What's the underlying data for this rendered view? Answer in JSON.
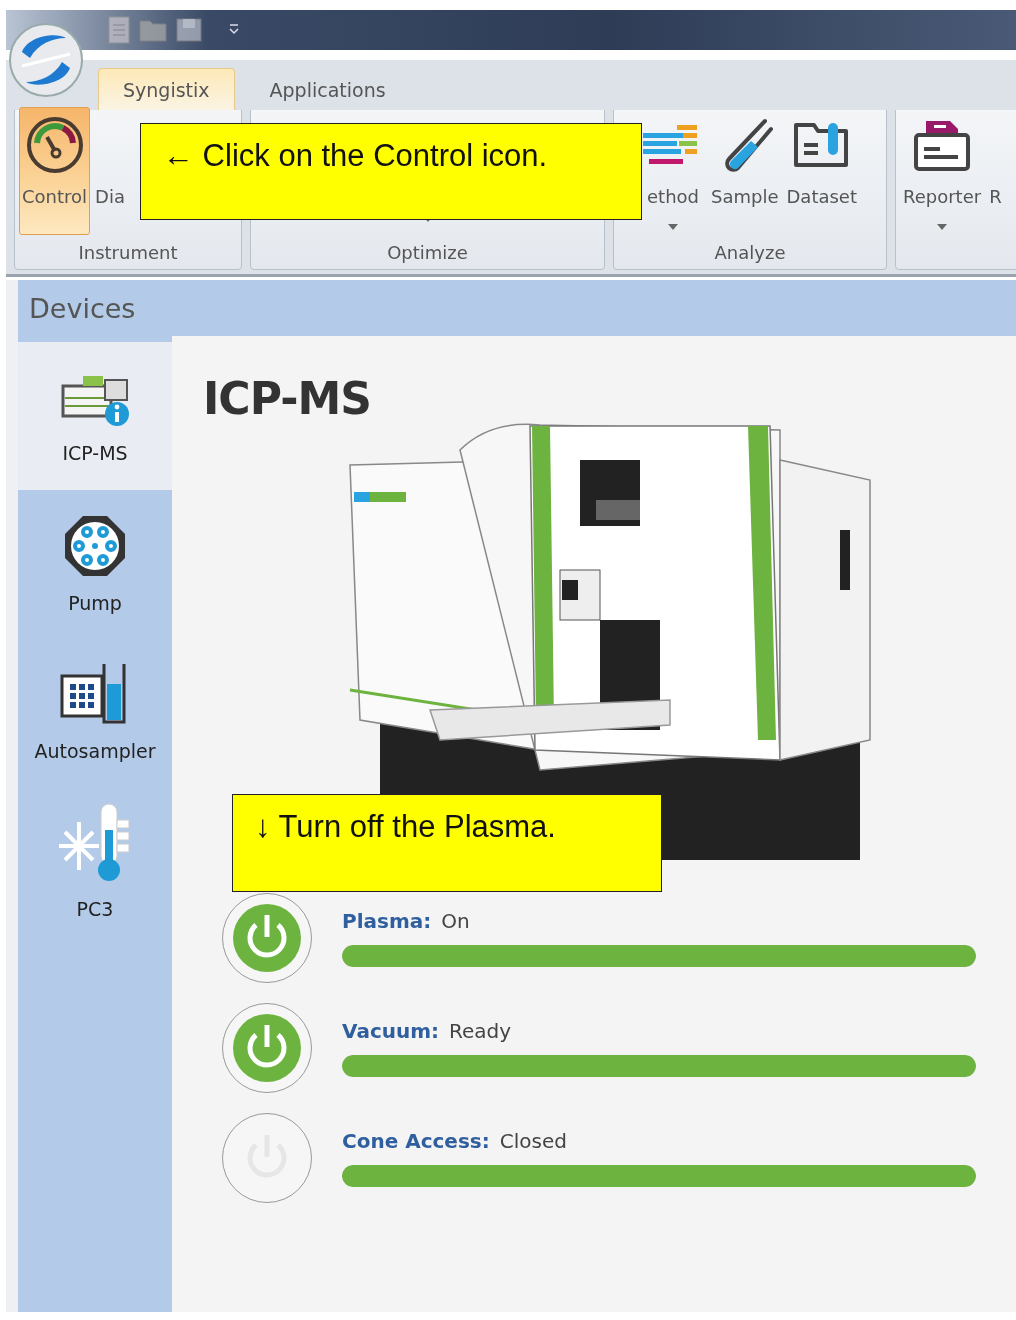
{
  "tabs": [
    {
      "label": "Syngistix",
      "selected": true
    },
    {
      "label": "Applications",
      "selected": false
    }
  ],
  "ribbon": {
    "groups": [
      {
        "label": "Instrument",
        "buttons": [
          {
            "label": "Control",
            "kind": "gauge",
            "selected": true,
            "dropdown": false
          },
          {
            "label": "Dia",
            "kind": "none",
            "selected": false,
            "dropdown": false
          }
        ]
      },
      {
        "label": "Optimize",
        "dropdown": true
      },
      {
        "label": "Analyze",
        "buttons": [
          {
            "label": "ethod",
            "kind": "bars",
            "selected": false,
            "dropdown": true
          },
          {
            "label": "Sample",
            "kind": "tube",
            "selected": false,
            "dropdown": false
          },
          {
            "label": "Dataset",
            "kind": "folder",
            "selected": false,
            "dropdown": false
          }
        ]
      },
      {
        "buttons": [
          {
            "label": "Reporter",
            "kind": "report",
            "selected": false,
            "dropdown": true
          },
          {
            "label": "R",
            "kind": "none",
            "selected": false,
            "dropdown": false
          }
        ]
      }
    ]
  },
  "panel": {
    "title": "Devices"
  },
  "sidebar": {
    "items": [
      {
        "label": "ICP-MS",
        "kind": "instrument",
        "selected": true
      },
      {
        "label": "Pump",
        "kind": "pump",
        "selected": false
      },
      {
        "label": "Autosampler",
        "kind": "autosampler",
        "selected": false
      },
      {
        "label": "PC3",
        "kind": "cooler",
        "selected": false
      }
    ]
  },
  "device": {
    "title": "ICP-MS"
  },
  "statuses": [
    {
      "label": "Plasma:",
      "value": "On",
      "on": true,
      "level": 1
    },
    {
      "label": "Vacuum:",
      "value": "Ready",
      "on": true,
      "level": 1
    },
    {
      "label": "Cone Access:",
      "value": "Closed",
      "on": false,
      "level": 1
    }
  ],
  "callouts": [
    {
      "text": "← Click on the Control icon."
    },
    {
      "text": "↓ Turn off the Plasma."
    }
  ]
}
